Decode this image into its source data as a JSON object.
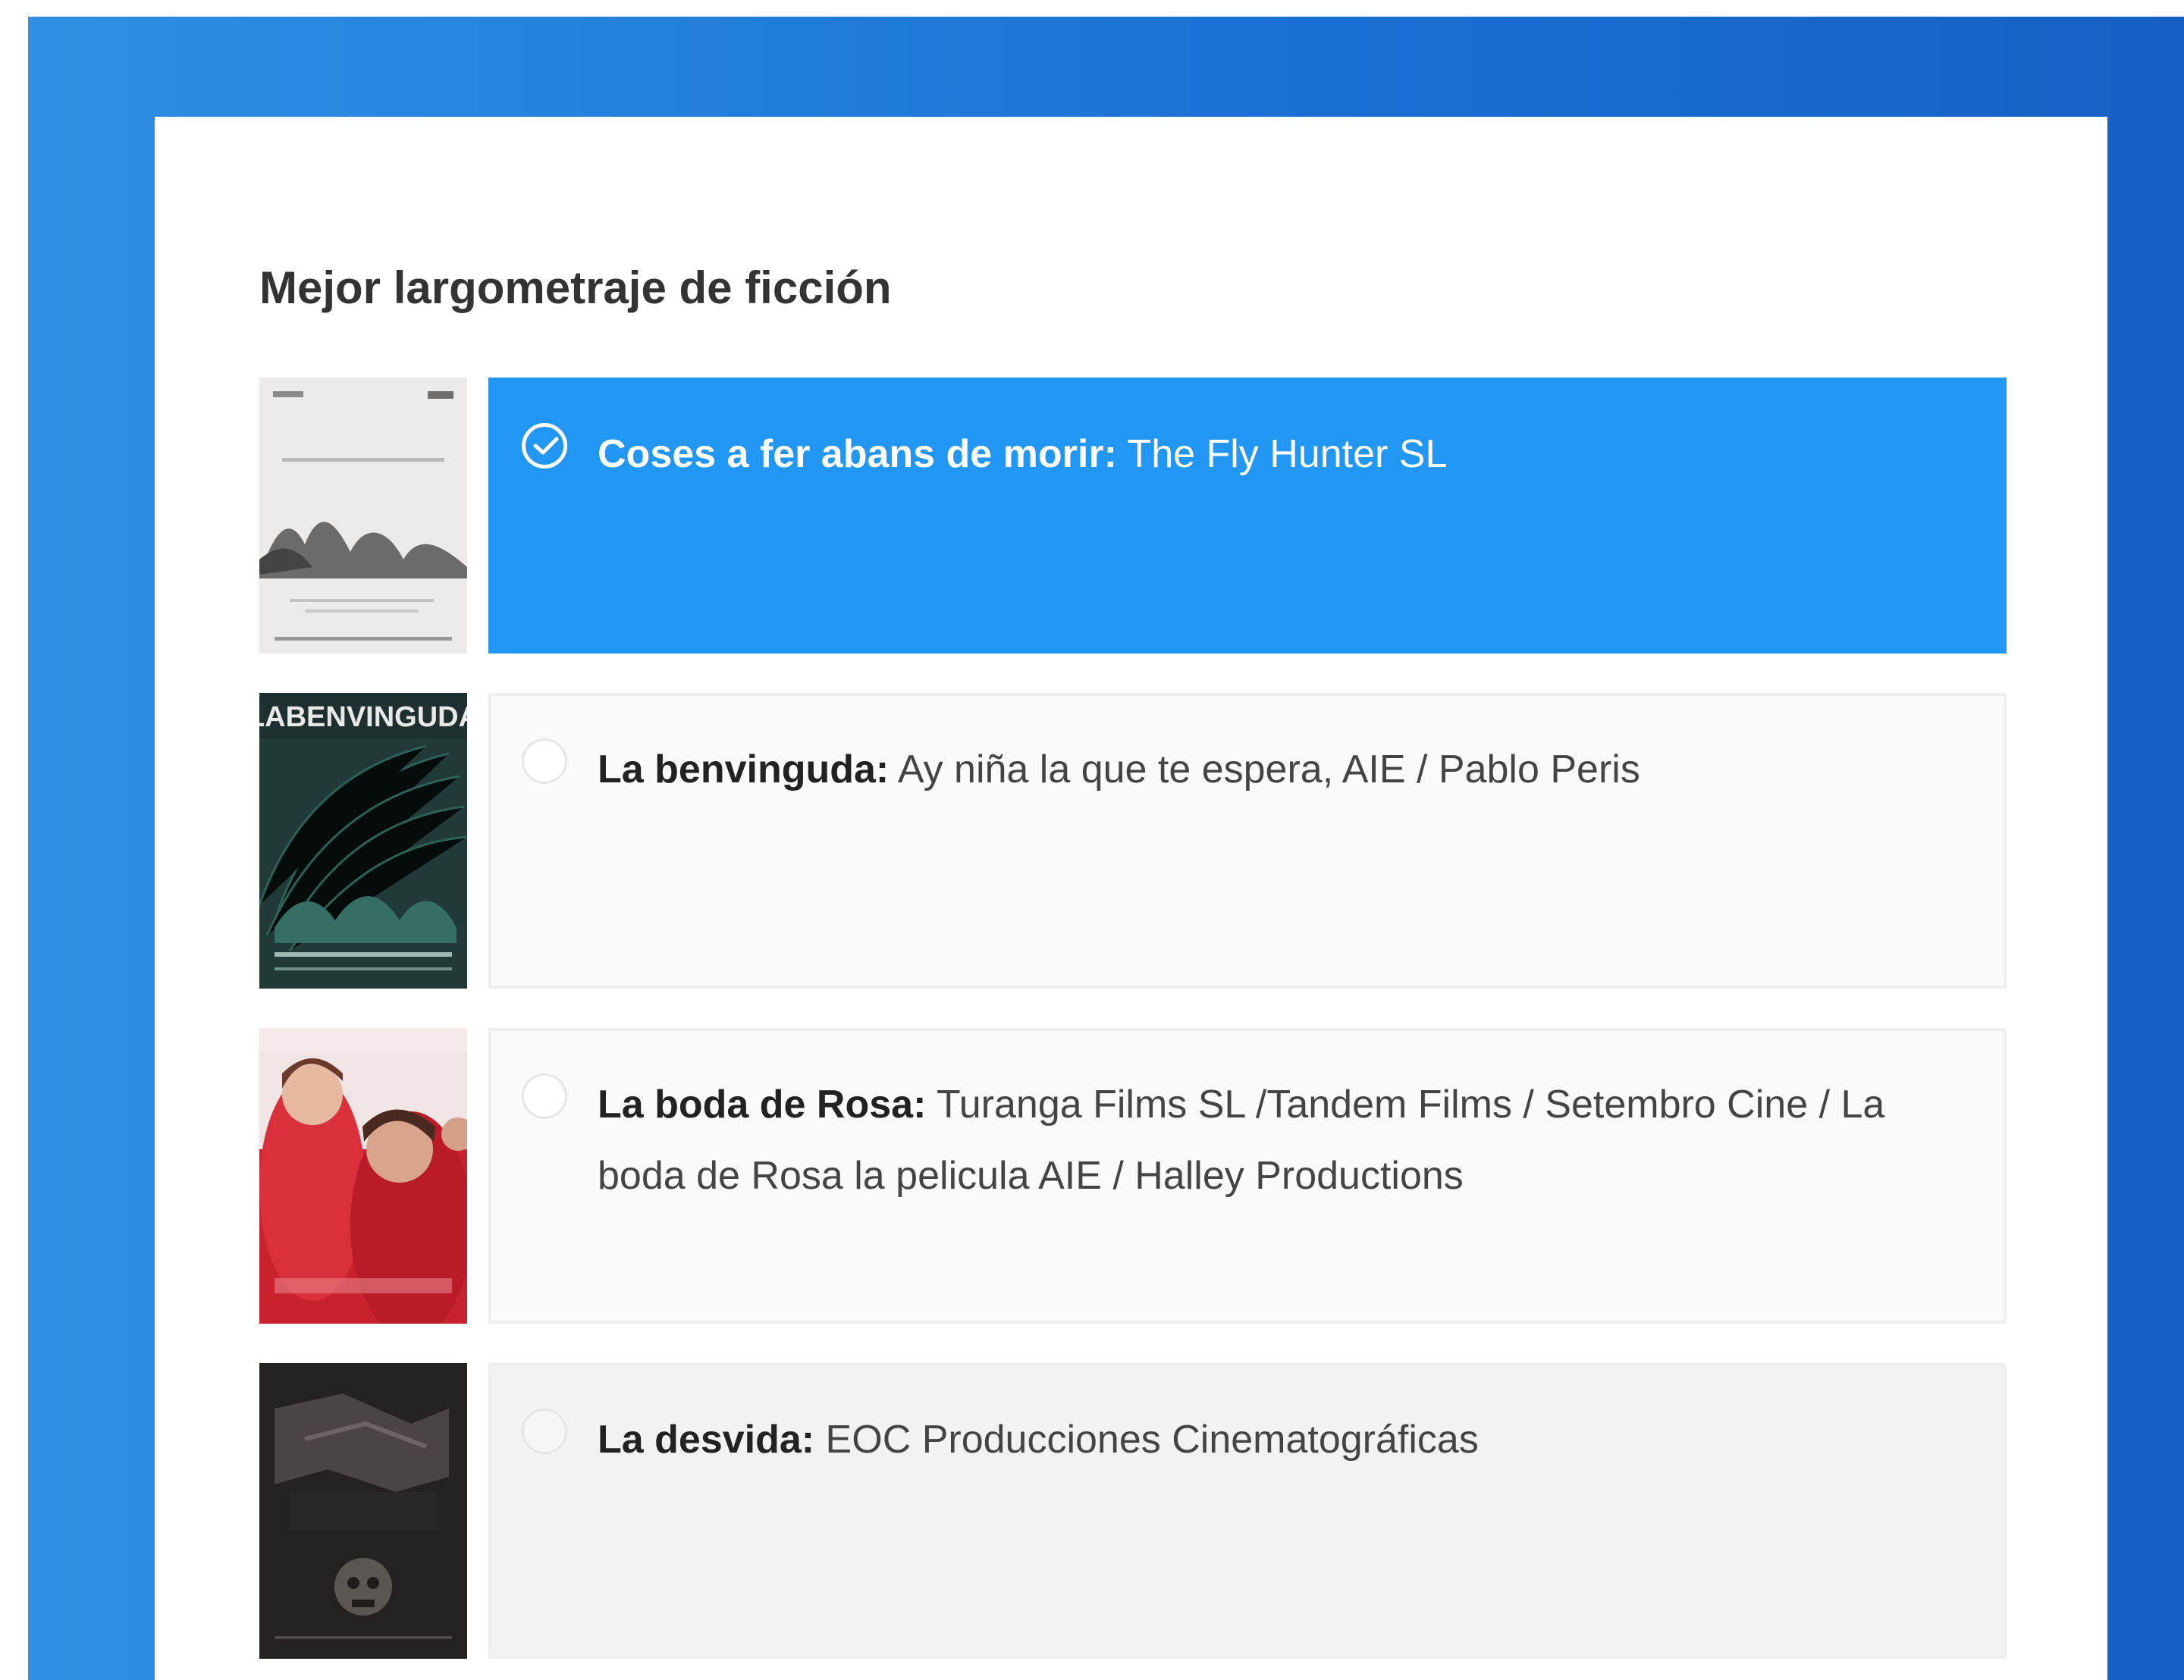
{
  "section": {
    "title": "Mejor largometraje de ficción"
  },
  "colors": {
    "background": "#1f77d8",
    "selected": "#2196f3",
    "option_bg": "#fafafa"
  },
  "options": [
    {
      "title": "Coses a fer abans de morir:",
      "producers": " The Fly Hunter SL",
      "selected": true,
      "poster_icon": "movie-poster-icon"
    },
    {
      "title": "La benvinguda:",
      "producers": " Ay niña la que te espera, AIE / Pablo Peris",
      "selected": false,
      "poster_icon": "movie-poster-icon"
    },
    {
      "title": "La boda de Rosa:",
      "producers": " Turanga Films SL /Tandem Films / Setembro Cine / La boda de Rosa la pelicula AIE / Halley Productions",
      "selected": false,
      "poster_icon": "movie-poster-icon"
    },
    {
      "title": "La desvida:",
      "producers": " EOC Producciones Cinematográficas",
      "selected": false,
      "poster_icon": "movie-poster-icon"
    }
  ]
}
